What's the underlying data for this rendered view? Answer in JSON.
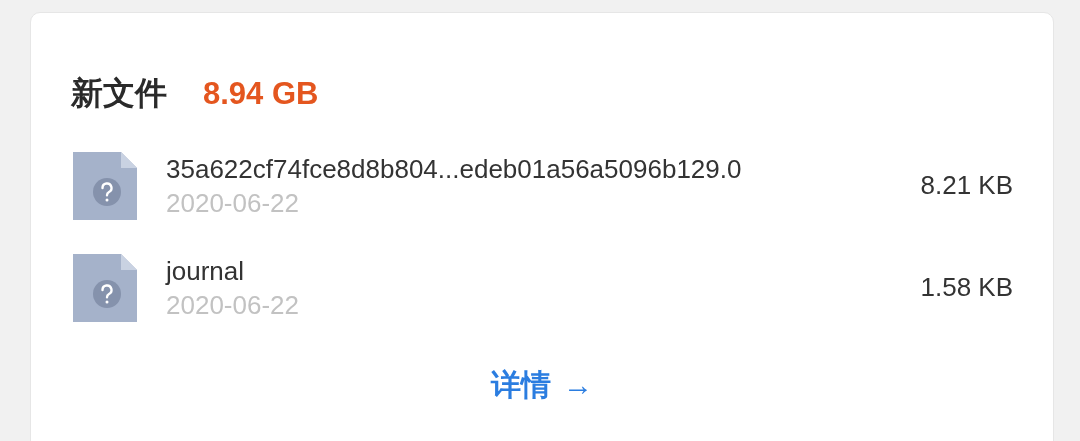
{
  "card": {
    "title": "新文件",
    "total": "8.94 GB",
    "files": [
      {
        "name": "35a622cf74fce8d8b804...edeb01a56a5096b129.0",
        "date": "2020-06-22",
        "size": "8.21 KB"
      },
      {
        "name": "journal",
        "date": "2020-06-22",
        "size": "1.58 KB"
      }
    ],
    "details_link": "详情",
    "details_arrow": "→"
  }
}
